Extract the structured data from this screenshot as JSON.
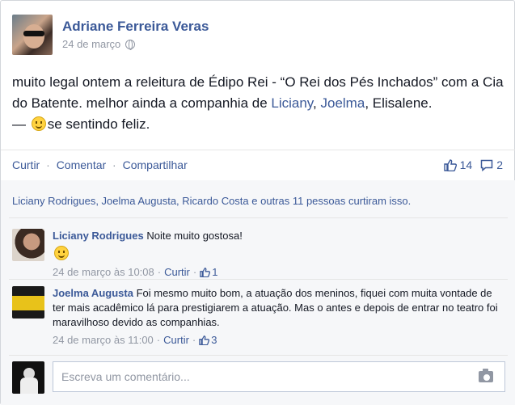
{
  "post": {
    "author": "Adriane Ferreira Veras",
    "date": "24 de março",
    "text_before": "muito legal ontem a releitura de Édipo Rei - “O Rei dos Pés Inchados” com a Cia do Batente. melhor ainda a companhia de ",
    "tag1": "Liciany",
    "tag_sep1": ", ",
    "tag2": "Joelma",
    "tag_sep2": ", Elisalene.",
    "feeling_prefix": "— ",
    "feeling": "se sentindo feliz."
  },
  "actions": {
    "like": "Curtir",
    "comment": "Comentar",
    "share": "Compartilhar",
    "sep": "·"
  },
  "stats": {
    "likes": "14",
    "comments": "2"
  },
  "likes_summary": "Liciany Rodrigues, Joelma Augusta, Ricardo Costa e outras 11 pessoas curtiram isso.",
  "comments": [
    {
      "name": "Liciany Rodrigues",
      "text": "Noite muito gostosa!",
      "time": "24 de março às 10:08",
      "like": "Curtir",
      "likes": "1"
    },
    {
      "name": "Joelma Augusta",
      "text": "Foi mesmo muito bom, a atuação dos meninos, fiquei com muita vontade de ter mais acadêmico lá para prestigiarem a atuação. Mas o antes e depois de entrar no teatro foi maravilhoso devido as companhias.",
      "time": "24 de março às 11:00",
      "like": "Curtir",
      "likes": "3"
    }
  ],
  "composer": {
    "placeholder": "Escreva um comentário..."
  },
  "icons": {
    "globe": "globe-icon",
    "thumb": "thumbs-up-icon",
    "comment": "comment-bubble-icon",
    "camera": "camera-icon",
    "smiley": "smiley-icon"
  },
  "colors": {
    "link": "#3b5998",
    "meta": "#9197a3",
    "text": "#141823"
  }
}
